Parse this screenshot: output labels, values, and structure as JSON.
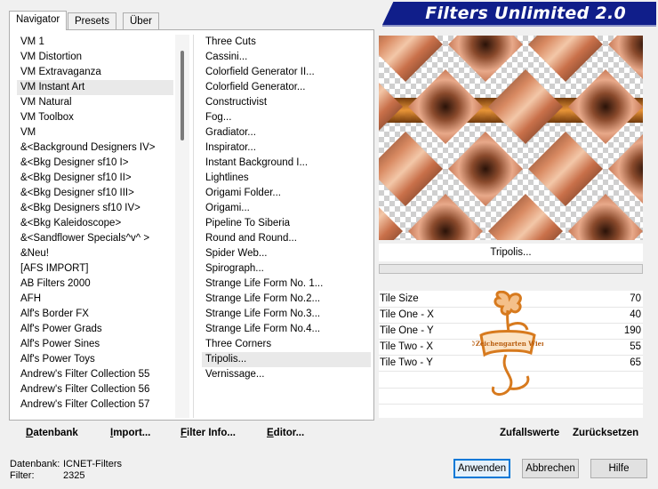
{
  "tabs": [
    "Navigator",
    "Presets",
    "Über"
  ],
  "banner_title": "Filters Unlimited 2.0",
  "categories": [
    "VM 1",
    "VM Distortion",
    "VM Extravaganza",
    "VM Instant Art",
    "VM Natural",
    "VM Toolbox",
    "VM",
    "&<Background Designers IV>",
    "&<Bkg Designer sf10 I>",
    "&<Bkg Designer sf10 II>",
    "&<Bkg Designer sf10 III>",
    "&<Bkg Designers sf10 IV>",
    "&<Bkg Kaleidoscope>",
    "&<Sandflower Specials^v^ >",
    "&Neu!",
    "[AFS IMPORT]",
    "AB Filters 2000",
    "AFH",
    "Alf's Border FX",
    "Alf's Power Grads",
    "Alf's Power Sines",
    "Alf's Power Toys",
    "Andrew's Filter Collection 55",
    "Andrew's Filter Collection 56",
    "Andrew's Filter Collection 57"
  ],
  "selected_category": "VM Instant Art",
  "filters": [
    "Three Cuts",
    "Cassini...",
    "Colorfield Generator II...",
    "Colorfield Generator...",
    "Constructivist",
    "Fog...",
    "Gradiator...",
    "Inspirator...",
    "Instant Background I...",
    "Lightlines",
    "Origami Folder...",
    "Origami...",
    "Pipeline To Siberia",
    "Round and Round...",
    "Spider Web...",
    "Spirograph...",
    "Strange Life Form No. 1...",
    "Strange Life Form No.2...",
    "Strange Life Form No.3...",
    "Strange Life Form No.4...",
    "Three Corners",
    "Tripolis...",
    "Vernissage..."
  ],
  "selected_filter": "Tripolis...",
  "preview_filter_name": "Tripolis...",
  "params": [
    {
      "label": "Tile Size",
      "value": "70"
    },
    {
      "label": "Tile One - X",
      "value": "40"
    },
    {
      "label": "Tile One - Y",
      "value": "190"
    },
    {
      "label": "Tile Two - X",
      "value": "55"
    },
    {
      "label": "Tile Two - Y",
      "value": "65"
    }
  ],
  "logo_text": "©Zeichengarten Wien",
  "bottom_buttons": {
    "datenbank": "Datenbank",
    "import": "Import...",
    "filter_info": "Filter Info...",
    "editor": "Editor...",
    "zufallswerte": "Zufallswerte",
    "zuruecksetzen": "Zurücksetzen"
  },
  "footer": {
    "datenbank_label": "Datenbank:",
    "datenbank_value": "ICNET-Filters",
    "filter_label": "Filter:",
    "filter_value": "2325"
  },
  "dialog_buttons": {
    "apply": "Anwenden",
    "cancel": "Abbrechen",
    "help": "Hilfe"
  },
  "colors": {
    "banner_bg": "#101e8a",
    "accent_orange": "#d77a1e",
    "tile_copper": "#c9704a"
  }
}
